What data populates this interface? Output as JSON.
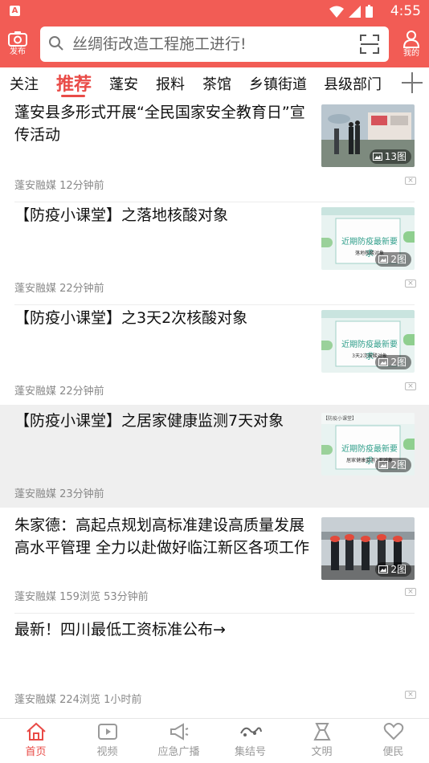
{
  "status_bar": {
    "badge": "A",
    "time": "4:55"
  },
  "header": {
    "post_label": "发布",
    "search_placeholder": "丝绸街改造工程施工进行!",
    "mine_label": "我的"
  },
  "tabs": [
    "关注",
    "推荐",
    "蓬安",
    "报料",
    "茶馆",
    "乡镇街道",
    "县级部门"
  ],
  "active_tab": "推荐",
  "feed": [
    {
      "title": "蓬安县多形式开展“全民国家安全教育日”宣传活动",
      "meta": "蓬安融媒 12分钟前",
      "img_count": "13图"
    },
    {
      "title": "【防疫小课堂】之落地核酸对象",
      "meta": "蓬安融媒 22分钟前",
      "img_count": "2图",
      "thumb_text": "近期防疫最新要求",
      "thumb_sub": "落地核酸对象"
    },
    {
      "title": "【防疫小课堂】之3天2次核酸对象",
      "meta": "蓬安融媒 22分钟前",
      "img_count": "2图",
      "thumb_text": "近期防疫最新要求",
      "thumb_sub": "3天2次核酸对象"
    },
    {
      "title": "【防疫小课堂】之居家健康监测7天对象",
      "meta": "蓬安融媒 23分钟前",
      "img_count": "2图",
      "thumb_text": "近期防疫最新要求",
      "thumb_sub": "居家健康监测7天对象",
      "thumb_tag": "【防疫小课堂】"
    },
    {
      "title": "朱家德：高起点规划高标准建设高质量发展高水平管理 全力以赴做好临江新区各项工作",
      "meta": "蓬安融媒 159浏览 53分钟前",
      "img_count": "2图"
    },
    {
      "title": "最新！四川最低工资标准公布→",
      "meta": "蓬安融媒 224浏览 1小时前"
    }
  ],
  "bottom_nav": [
    {
      "label": "首页",
      "icon": "home-icon",
      "active": true
    },
    {
      "label": "视频",
      "icon": "video-icon"
    },
    {
      "label": "应急广播",
      "icon": "megaphone-icon"
    },
    {
      "label": "集结号",
      "icon": "gathering-logo-icon"
    },
    {
      "label": "文明",
      "icon": "civilization-icon"
    },
    {
      "label": "便民",
      "icon": "heart-icon"
    }
  ],
  "colors": {
    "brand_red": "#f25c55",
    "active_red": "#e94b47"
  }
}
